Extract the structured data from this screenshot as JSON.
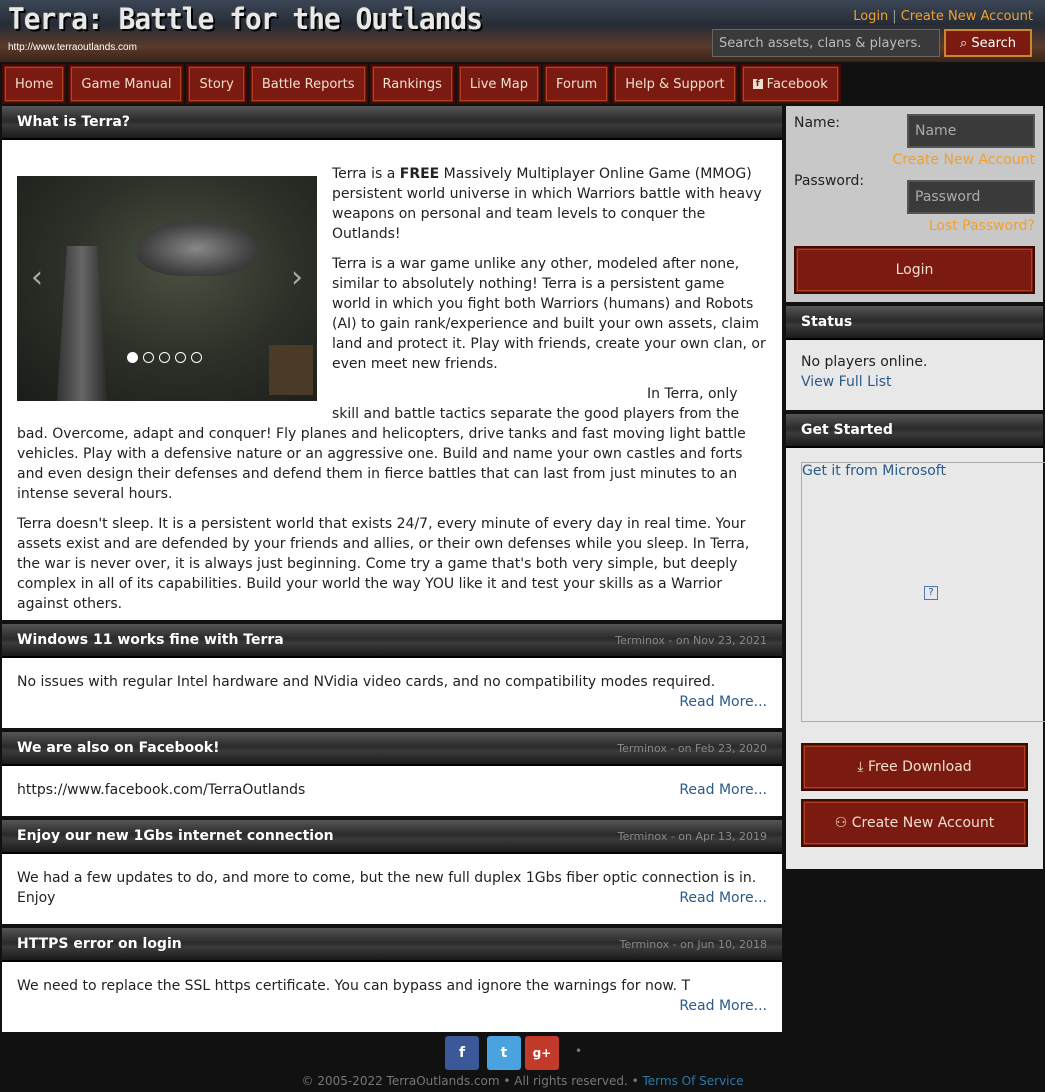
{
  "header": {
    "title": "Terra: Battle for the Outlands",
    "url": "http://www.terraoutlands.com",
    "login_link": "Login",
    "separator": "|",
    "create_account_link": "Create New Account",
    "search_placeholder": "Search assets, clans & players.",
    "search_button": "Search"
  },
  "nav": {
    "items": [
      "Home",
      "Game Manual",
      "Story",
      "Battle Reports",
      "Rankings",
      "Live Map",
      "Forum",
      "Help & Support",
      "Facebook"
    ]
  },
  "main": {
    "intro": {
      "title": "What is Terra?",
      "p1_pre": "Terra is a ",
      "p1_bold": "FREE",
      "p1_post": " Massively Multiplayer Online Game (MMOG) persistent world universe in which Warriors battle with heavy weapons on personal and team levels to conquer the Outlands!",
      "p2": "Terra is a war game unlike any other, modeled after none, similar to absolutely nothing! Terra is a persistent game world in which you fight both Warriors (humans) and Robots (AI) to gain rank/experience and built your own assets, claim land and protect it. Play with friends, create your own clan, or even meet new friends.",
      "p3": "In Terra, only skill and battle tactics separate the good players from the bad. Overcome, adapt and conquer! Fly planes and helicopters, drive tanks and fast moving light battle vehicles. Play with a defensive nature or an aggressive one. Build and name your own castles and forts and even design their defenses and defend them in fierce battles that can last from just minutes to an intense several hours.",
      "p4": "Terra doesn't sleep. It is a persistent world that exists 24/7, every minute of every day in real time. Your assets exist and are defended by your friends and allies, or their own defenses while you sleep. In Terra, the war is never over, it is always just beginning. Come try a game that's both very simple, but deeply complex in all of its capabilities. Build your world the way YOU like it and test your skills as a Warrior against others."
    },
    "news": [
      {
        "title": "Windows 11 works fine with Terra",
        "meta": "Terminox - on Nov 23, 2021",
        "body": "No issues with regular Intel hardware and NVidia video cards, and no compatibility modes required.",
        "more": "Read More..."
      },
      {
        "title": "We are also on Facebook!",
        "meta": "Terminox - on Feb 23, 2020",
        "body": "https://www.facebook.com/TerraOutlands",
        "more": "Read More..."
      },
      {
        "title": "Enjoy our new 1Gbs internet connection",
        "meta": "Terminox - on Apr 13, 2019",
        "body": "We had a few updates to do, and more to come, but the new full duplex 1Gbs fiber optic connection is in. Enjoy",
        "more": "Read More..."
      },
      {
        "title": "HTTPS error on login",
        "meta": "Terminox - on Jun 10, 2018",
        "body": "We need to replace the SSL  https certificate.  You can bypass and ignore the warnings for now.  T",
        "more": "Read More..."
      }
    ]
  },
  "sidebar": {
    "login": {
      "name_label": "Name:",
      "name_placeholder": "Name",
      "create_account": "Create New Account",
      "password_label": "Password:",
      "password_placeholder": "Password",
      "lost_password": "Lost Password?",
      "login_button": "Login"
    },
    "status": {
      "title": "Status",
      "text": "No players online.",
      "link": "View Full List"
    },
    "started": {
      "title": "Get Started",
      "ms_link": "Get it from Microsoft",
      "ms_icon": "?",
      "download": "Free Download",
      "create": "Create New Account"
    }
  },
  "footer": {
    "copyright": "© 2005-2022 TerraOutlands.com • All rights reserved. •",
    "tos": "Terms Of Service",
    "social": [
      "f",
      "t",
      "g+"
    ],
    "dot": "•"
  },
  "colors": {
    "accent": "#f0a030",
    "button": "#7a1a10",
    "link": "#2a5a8a"
  }
}
